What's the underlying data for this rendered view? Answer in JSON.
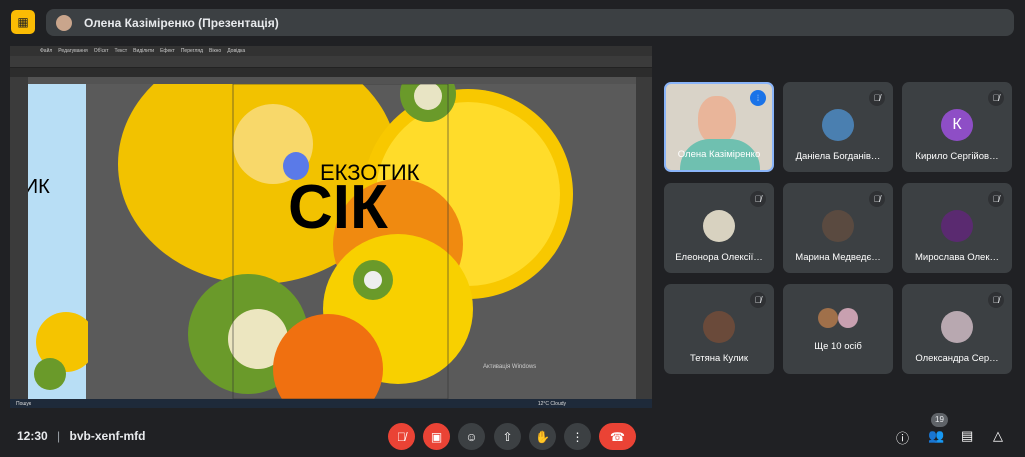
{
  "presentation": {
    "title": "Олена Казіміренко (Презентація)",
    "icon": "present-off-icon"
  },
  "shared_screen": {
    "menu": [
      "Файл",
      "Редагування",
      "Об'єкт",
      "Текст",
      "Виділити",
      "Ефект",
      "Перегляд",
      "Вікно",
      "Довідка"
    ],
    "artwork_small": "ЕКЗОТИК",
    "artwork_big": "СІК",
    "watermark": "Активація Windows",
    "taskbar": {
      "search": "Пошук",
      "weather": "12°C Cloudy"
    }
  },
  "participants": [
    {
      "name": "Олена Казіміренко",
      "speaking": true,
      "video": true
    },
    {
      "name": "Даніела Богданів…",
      "muted": true,
      "color": "#4a7fb0"
    },
    {
      "name": "Кирило Сергійов…",
      "muted": true,
      "initial": "К",
      "color": "#8e4ec6"
    },
    {
      "name": "Елеонора Олексії…",
      "muted": true,
      "color": "#d8d2c0"
    },
    {
      "name": "Марина Медведє…",
      "muted": true,
      "color": "#5a4a40"
    },
    {
      "name": "Мирослава Олек…",
      "muted": true,
      "color": "#5a2a70"
    },
    {
      "name": "Тетяна Кулик",
      "muted": true,
      "color": "#6a4a3a"
    },
    {
      "name": "Ще 10 осіб"
    },
    {
      "name": "Олександра Сер…",
      "muted": true,
      "color": "#b8a8b0"
    }
  ],
  "footer": {
    "time": "12:30",
    "meeting_code": "bvb-xenf-mfd",
    "participant_count": "19"
  },
  "colors": {
    "accent": "#8ab4f8",
    "danger": "#ea4335",
    "presenting": "#fbbc04"
  }
}
